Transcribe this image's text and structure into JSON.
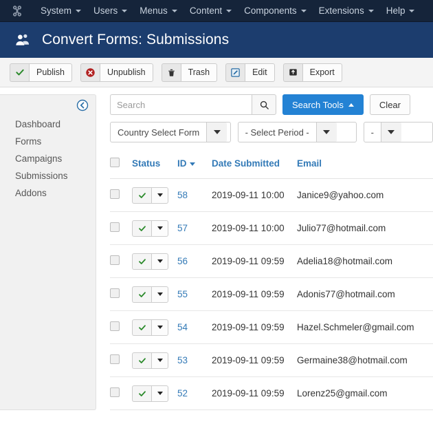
{
  "adminbar": {
    "logo_icon": "joomla-logo-icon",
    "menus": [
      {
        "label": "System"
      },
      {
        "label": "Users"
      },
      {
        "label": "Menus"
      },
      {
        "label": "Content"
      },
      {
        "label": "Components"
      },
      {
        "label": "Extensions"
      },
      {
        "label": "Help"
      }
    ]
  },
  "header": {
    "icon": "users-icon",
    "title": "Convert Forms: Submissions",
    "background_color": "#1c3d6e"
  },
  "toolbar": {
    "buttons": [
      {
        "label": "Publish",
        "icon": "check-icon"
      },
      {
        "label": "Unpublish",
        "icon": "circle-x-icon"
      },
      {
        "label": "Trash",
        "icon": "trash-icon"
      },
      {
        "label": "Edit",
        "icon": "pencil-square-icon"
      },
      {
        "label": "Export",
        "icon": "export-box-icon"
      }
    ]
  },
  "sidebar": {
    "collapse_icon": "circle-arrow-left-icon",
    "items": [
      {
        "label": "Dashboard"
      },
      {
        "label": "Forms"
      },
      {
        "label": "Campaigns"
      },
      {
        "label": "Submissions"
      },
      {
        "label": "Addons"
      }
    ]
  },
  "search": {
    "value": "",
    "placeholder": "Search",
    "search_icon": "search-icon",
    "tools_label": "Search Tools",
    "clear_label": "Clear",
    "accent_color": "#2382d4"
  },
  "filters": {
    "form": {
      "value": "Country Select Form"
    },
    "period": {
      "value": "- Select Period -"
    },
    "third": {
      "value": "-"
    }
  },
  "table": {
    "columns": [
      {
        "label": "",
        "key": "checkbox"
      },
      {
        "label": "Status",
        "key": "status"
      },
      {
        "label": "ID",
        "key": "id",
        "sorted": true,
        "sort_dir": "desc"
      },
      {
        "label": "Date Submitted",
        "key": "date"
      },
      {
        "label": "Email",
        "key": "email"
      }
    ],
    "rows": [
      {
        "id": "58",
        "date": "2019-09-11 10:00",
        "email": "Janice9@yahoo.com",
        "status": "published"
      },
      {
        "id": "57",
        "date": "2019-09-11 10:00",
        "email": "Julio77@hotmail.com",
        "status": "published"
      },
      {
        "id": "56",
        "date": "2019-09-11 09:59",
        "email": "Adelia18@hotmail.com",
        "status": "published"
      },
      {
        "id": "55",
        "date": "2019-09-11 09:59",
        "email": "Adonis77@hotmail.com",
        "status": "published"
      },
      {
        "id": "54",
        "date": "2019-09-11 09:59",
        "email": "Hazel.Schmeler@gmail.com",
        "status": "published"
      },
      {
        "id": "53",
        "date": "2019-09-11 09:59",
        "email": "Germaine38@hotmail.com",
        "status": "published"
      },
      {
        "id": "52",
        "date": "2019-09-11 09:59",
        "email": "Lorenz25@gmail.com",
        "status": "published"
      }
    ]
  }
}
